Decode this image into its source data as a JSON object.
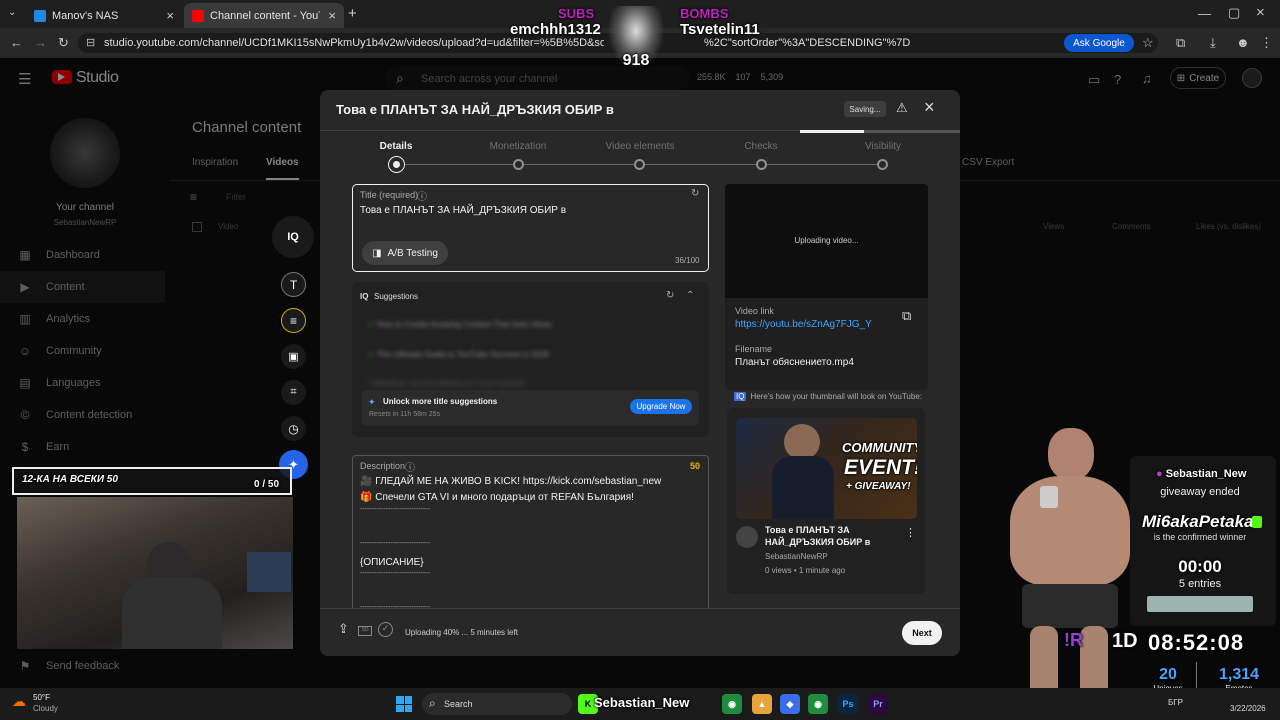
{
  "browser": {
    "tabs": [
      {
        "label": "Manov's NAS",
        "fav_color": "#1e88e5"
      },
      {
        "label": "Channel content - YouTube Stu",
        "fav_color": "#ff0000"
      }
    ],
    "new_tab_symbol": "+",
    "url": "studio.youtube.com/channel/UCDf1MKI15sNwPkmUy1b4v2w/videos/upload?d=ud&filter=%5B%5D&sort=%7B\"columnTy",
    "url_tail": "%2C\"sortOrder\"%3A\"DESCENDING\"%7D",
    "ask_google": "Ask Google"
  },
  "stream_top": {
    "subs_label": "SUBS",
    "subs_name": "emchhh1312",
    "bombs_label": "BOMBS",
    "bombs_name": "Tsvetelin11",
    "badge_number": "918"
  },
  "studio": {
    "logo_text": "Studio",
    "search_placeholder": "Search across your channel",
    "stats": [
      "255.8K",
      "107",
      "5,309"
    ],
    "create_label": "Create",
    "page_title": "Channel content",
    "tabs": [
      "Inspiration",
      "Videos"
    ],
    "csv_export": "CSV Export",
    "filter_placeholder": "Filter",
    "columns": {
      "video": "Video",
      "views": "Views",
      "comments": "Comments",
      "likes": "Likes (vs. dislikes)"
    },
    "your_channel": "Your channel",
    "channel_name": "SebastianNewRP",
    "sidebar": [
      {
        "label": "Dashboard",
        "icon": "dashboard-icon",
        "glyph": "▦"
      },
      {
        "label": "Content",
        "icon": "content-icon",
        "glyph": "▶"
      },
      {
        "label": "Analytics",
        "icon": "analytics-icon",
        "glyph": "▥"
      },
      {
        "label": "Community",
        "icon": "community-icon",
        "glyph": "☺"
      },
      {
        "label": "Languages",
        "icon": "languages-icon",
        "glyph": "▤"
      },
      {
        "label": "Content detection",
        "icon": "copyright-icon",
        "glyph": "©"
      },
      {
        "label": "Earn",
        "icon": "earn-icon",
        "glyph": "$"
      }
    ],
    "send_feedback": "Send feedback"
  },
  "modal": {
    "title": "Това е ПЛАНЪТ ЗА НАЙ_ДРЪЗКИЯ ОБИР в",
    "saving": "Saving...",
    "steps": [
      "Details",
      "Monetization",
      "Video elements",
      "Checks",
      "Visibility"
    ],
    "title_field": {
      "label": "Title (required)",
      "value": "Това е ПЛАНЪТ ЗА НАЙ_ДРЪЗКИЯ ОБИР в",
      "ab_testing": "A/B Testing",
      "counter": "36/100"
    },
    "suggestions": {
      "label": "Suggestions",
      "items": [
        "How to Create Amazing Content That Gets Views",
        "The Ultimate Guide to YouTube Success in 2026",
        "7 Mistakes You Are Making on Your Channel"
      ],
      "unlock_title": "Unlock more title suggestions",
      "resets": "Resets in 11h 58m 25s",
      "upgrade": "Upgrade Now"
    },
    "description": {
      "label": "Description",
      "counter": "50",
      "lines": [
        "🎥 ГЛЕДАЙ МЕ НА ЖИВО В KICK! https://kick.com/sebastian_new",
        "🎁 Спечели GTA VI и много подаръци от REFAN България!",
        "------------------------------",
        "------------------------------",
        "{ОПИСАНИЕ}",
        "------------------------------",
        "------------------------------"
      ]
    },
    "preview": {
      "uploading": "Uploading video...",
      "video_link_label": "Video link",
      "video_link": "https://youtu.be/sZnAg7FJG_Y",
      "filename_label": "Filename",
      "filename": "Планът обяснението.mp4",
      "thumb_hint": "Here's how your thumbnail will look on YouTube:",
      "thumb_text_1": "COMMUNITY",
      "thumb_text_2": "EVENT!",
      "thumb_text_3": "+ GIVEAWAY!",
      "card_title": "Това е ПЛАНЪТ ЗА НАЙ_ДРЪЗКИЯ ОБИР в",
      "card_channel": "SebastianNewRP",
      "card_meta": "0 views • 1 minute ago"
    },
    "footer_status": "Uploading 40% ... 5 minutes left",
    "upload_progress": 0.4,
    "next": "Next"
  },
  "stream_overlay": {
    "goal_label": "12-КА НА ВСЕКИ 50",
    "goal_count": "0 / 50",
    "giveaway": {
      "host": "Sebastian_New",
      "status": "giveaway ended",
      "winner": "Mi6akaPetaka",
      "winner_note": "is the confirmed winner",
      "timer": "00:00",
      "entries": "5 entries"
    },
    "command": "!R",
    "countdown_days": "1D",
    "countdown_time": "08:52:08",
    "uniques_value": "20",
    "uniques_label": "Uniques",
    "emotes_value": "1,314",
    "emotes_label": "Emotes"
  },
  "taskbar": {
    "weather_temp": "50°F",
    "weather_desc": "Cloudy",
    "search": "Search",
    "streamer_tag": "Sebastian_New",
    "lang": "БГР",
    "date": "3/22/2026"
  }
}
